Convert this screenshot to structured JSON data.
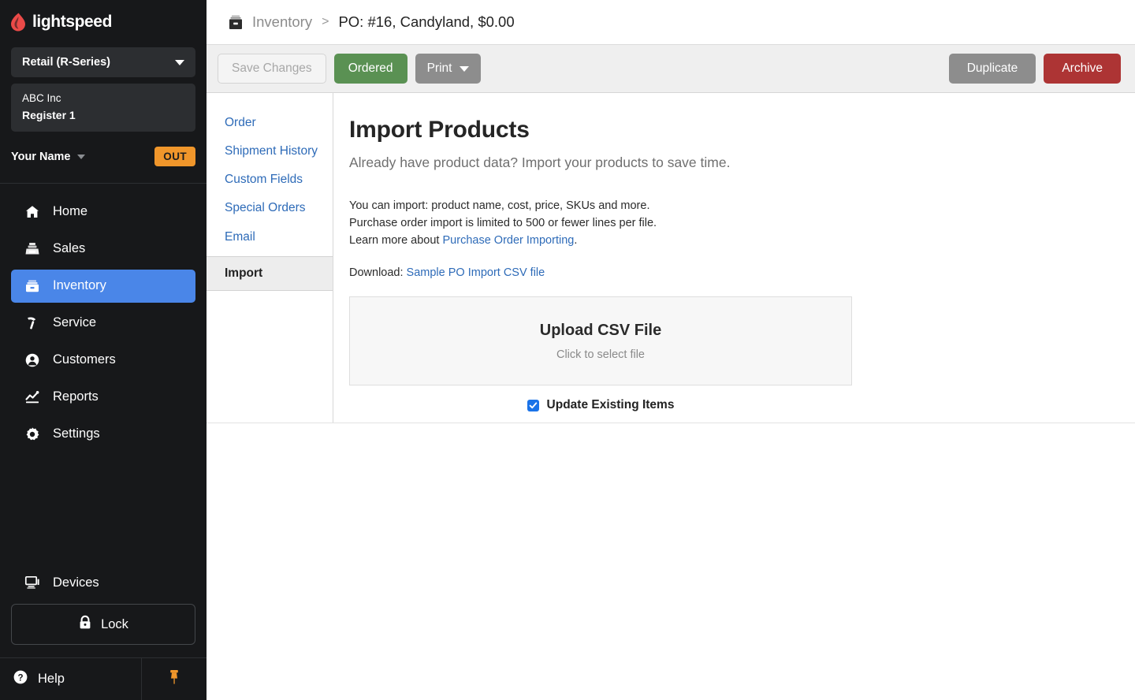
{
  "sidebar": {
    "logo": {
      "icon": "lightspeed-flame-icon",
      "word": "lightspeed"
    },
    "series_selector": {
      "label": "Retail (R-Series)",
      "icon": "chevron-down-icon"
    },
    "store": {
      "company": "ABC Inc",
      "register": "Register 1"
    },
    "user": {
      "name": "Your Name",
      "caret_icon": "chevron-down-icon",
      "status_badge": "OUT"
    },
    "nav_items": [
      {
        "label": "Home",
        "icon": "home-icon",
        "active": false
      },
      {
        "label": "Sales",
        "icon": "cash-register-icon",
        "active": false
      },
      {
        "label": "Inventory",
        "icon": "inventory-box-icon",
        "active": true
      },
      {
        "label": "Service",
        "icon": "hammer-icon",
        "active": false
      },
      {
        "label": "Customers",
        "icon": "person-circle-icon",
        "active": false
      },
      {
        "label": "Reports",
        "icon": "chart-line-icon",
        "active": false
      },
      {
        "label": "Settings",
        "icon": "gear-icon",
        "active": false
      }
    ],
    "devices": {
      "label": "Devices",
      "icon": "monitor-icon"
    },
    "lock": {
      "label": "Lock",
      "icon": "lock-icon"
    },
    "help": {
      "label": "Help",
      "icon": "question-circle-icon"
    },
    "pin": {
      "icon": "pushpin-icon"
    },
    "colors": {
      "background": "#17181a",
      "active_nav": "#4a86e8",
      "badge_orange": "#f0962b",
      "pin_orange": "#f0962b"
    }
  },
  "breadcrumb": {
    "icon": "inventory-box-icon",
    "parent": "Inventory",
    "separator": ">",
    "current": "PO:  #16, Candyland, $0.00"
  },
  "toolbar": {
    "save_changes": "Save Changes",
    "ordered": "Ordered",
    "print": "Print",
    "print_caret_icon": "chevron-down-icon",
    "duplicate": "Duplicate",
    "archive": "Archive",
    "colors": {
      "ordered_green": "#5a9153",
      "print_grey": "#8d8d8d",
      "duplicate_grey": "#8d8d8d",
      "archive_red": "#ad3434",
      "bar_background": "#efefef"
    }
  },
  "subnav": {
    "items": [
      {
        "label": "Order",
        "active": false
      },
      {
        "label": "Shipment History",
        "active": false
      },
      {
        "label": "Custom Fields",
        "active": false
      },
      {
        "label": "Special Orders",
        "active": false
      },
      {
        "label": "Email",
        "active": false
      },
      {
        "label": "Import",
        "active": true
      }
    ],
    "link_color": "#2e6bb8"
  },
  "content": {
    "title": "Import Products",
    "subtitle": "Already have product data? Import your products to save time.",
    "info_line_1": "You can import: product name, cost, price, SKUs and more.",
    "info_line_2": "Purchase order import is limited to 500 or fewer lines per file.",
    "info_line_3_prefix": "Learn more about ",
    "info_line_3_link": "Purchase Order Importing",
    "info_line_3_suffix": ".",
    "download_prefix": "Download: ",
    "download_link": "Sample PO Import CSV file",
    "dropzone": {
      "title": "Upload CSV File",
      "subtitle": "Click to select file"
    },
    "checkbox": {
      "label": "Update Existing Items",
      "checked": true,
      "color": "#1a73e8"
    }
  }
}
